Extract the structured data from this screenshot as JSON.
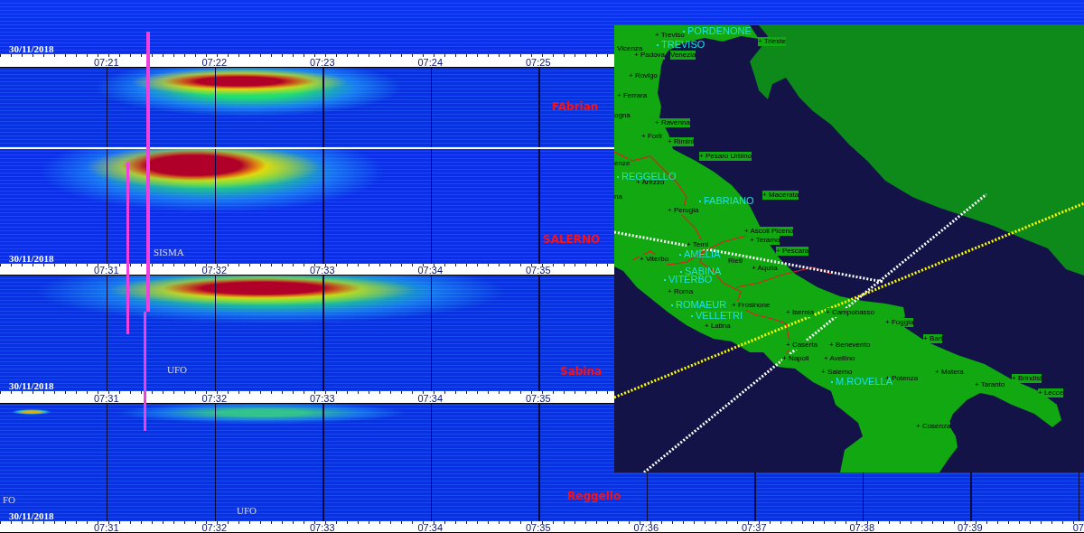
{
  "sections": [
    {
      "kind": "spectrogram",
      "date": "30/11/2018"
    },
    {
      "kind": "axis",
      "labels": [
        "07:21",
        "07:22",
        "07:23",
        "07:24",
        "07:25"
      ]
    },
    {
      "kind": "spectrogram",
      "station": "FAbrian"
    },
    {
      "kind": "spectrogram",
      "station": "SALERNO",
      "notes": [
        "SISMA"
      ],
      "date": "30/11/2018"
    },
    {
      "kind": "axis",
      "labels": [
        "07:31",
        "07:32",
        "07:33",
        "07:34",
        "07:35"
      ]
    },
    {
      "kind": "spectrogram",
      "station": "Sabina",
      "notes": [
        "UFO"
      ],
      "date": "30/11/2018"
    },
    {
      "kind": "axis",
      "labels": [
        "07:31",
        "07:32",
        "07:33",
        "07:34",
        "07:35"
      ]
    },
    {
      "kind": "spectrogram",
      "station": "Reggello",
      "notes": [
        "FO",
        "UFO"
      ],
      "date": "30/11/2018"
    },
    {
      "kind": "axis",
      "labels": [
        "07:31",
        "07:32",
        "07:33",
        "07:34",
        "07:35",
        "07:36",
        "07:37",
        "07:38",
        "07:39",
        "07"
      ]
    }
  ],
  "map": {
    "stations": [
      "PORDENONE",
      "TREVISO",
      "REGGELLO",
      "FABRIANO",
      "AMELIA",
      "SABINA",
      "VITERBO",
      "ROMAEUR",
      "VELLETRI",
      "M.ROVELLA"
    ],
    "cities": [
      "+ Treviso",
      "+ Trieste",
      "Vicenza",
      "+ Padova",
      "Venezia",
      "+ Rovigo",
      "+ Ferrara",
      "ogna",
      "+ Ravenna",
      "+ Forlì",
      "+ Rimini",
      "+ Pesaro Urbino",
      "enze",
      "+ Arezzo",
      "na",
      "+ Macerata",
      "+ Perugia",
      "+ Ascoli Piceno",
      "+ Teramo",
      "+ Terni",
      "+ Viterbo",
      "Rieti",
      "+ Aquila",
      "+ Pescara",
      "+ Roma",
      "+ Frosinone",
      "+ Latina",
      "+ Isernia",
      "+ Campobasso",
      "+ Foggia",
      "+ Bari",
      "+ Caserta",
      "+ Benevento",
      "+ Napoli",
      "+ Avellino",
      "+ Salerno",
      "+ Potenza",
      "+ Matera",
      "+ Taranto",
      "+ Brindisi",
      "+ Lecce",
      "+ Cosenza"
    ]
  }
}
